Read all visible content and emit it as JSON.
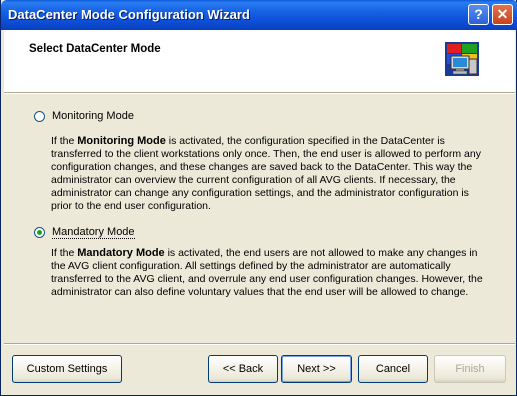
{
  "window": {
    "title": "DataCenter Mode Configuration Wizard",
    "help_glyph": "?",
    "close_glyph": "✕"
  },
  "header": {
    "title": "Select DataCenter Mode",
    "icon": "computer-network-icon"
  },
  "options": {
    "monitoring": {
      "label": "Monitoring Mode",
      "selected": false,
      "desc_prefix": "If the ",
      "desc_bold": "Monitoring Mode",
      "desc_rest": " is activated, the configuration specified in the DataCenter is transferred to the client workstations only once. Then, the end user is allowed to perform any configuration changes, and these changes are saved back to the DataCenter. This way the administrator can overview the current configuration of all AVG clients. If necessary, the administrator can change any configuration settings, and the administrator configuration is prior to the end user configuration."
    },
    "mandatory": {
      "label": "Mandatory Mode",
      "selected": true,
      "desc_prefix": "If the ",
      "desc_bold": "Mandatory Mode",
      "desc_rest": " is activated, the end users are not allowed to make any changes in the AVG client configuration. All settings defined by the administrator are automatically transferred to the AVG client, and overrule any end user configuration changes. However, the administrator can also define voluntary values that the end user will be allowed to change."
    }
  },
  "buttons": {
    "custom_settings": "Custom Settings",
    "back": "<< Back",
    "next": "Next >>",
    "cancel": "Cancel",
    "finish": "Finish"
  }
}
